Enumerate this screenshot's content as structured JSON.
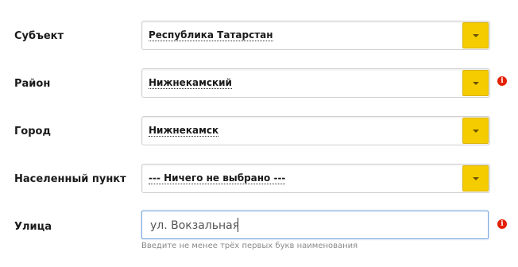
{
  "fields": {
    "subject": {
      "label": "Субъект",
      "value": "Республика Татарстан"
    },
    "district": {
      "label": "Район",
      "value": "Нижнекамский"
    },
    "city": {
      "label": "Город",
      "value": "Нижнекамск"
    },
    "settlement": {
      "label": "Населенный пункт",
      "value": "--- Ничего не выбрано ---"
    },
    "street": {
      "label": "Улица",
      "value": "ул. Вокзальная",
      "hint": "Введите не менее трёх первых букв наименования"
    }
  },
  "icons": {
    "dropdown": "chevron-down-icon",
    "warning": "warning-icon",
    "warning_glyph": "i"
  },
  "colors": {
    "dropdown_button": "#f5cc00",
    "warning": "#e32000",
    "input_focus_border": "#7aa7e0",
    "hint_text": "#8a8a8a"
  }
}
